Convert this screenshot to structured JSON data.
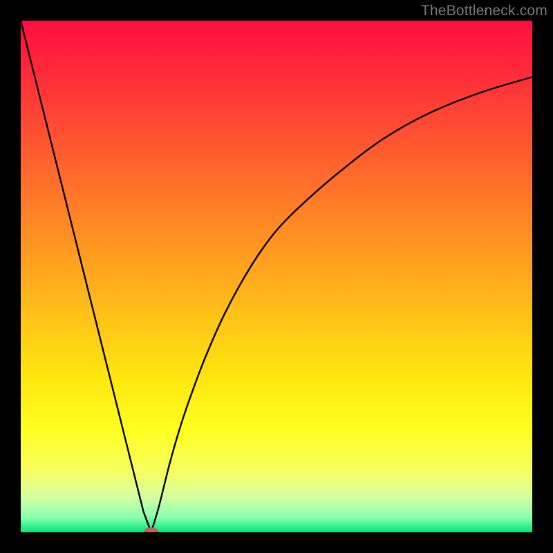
{
  "watermark": "TheBottleneck.com",
  "colors": {
    "gradient_stops": [
      {
        "offset": 0.0,
        "color": "#ff0e3f"
      },
      {
        "offset": 0.1,
        "color": "#ff2a3a"
      },
      {
        "offset": 0.25,
        "color": "#ff5a2f"
      },
      {
        "offset": 0.4,
        "color": "#ff8a24"
      },
      {
        "offset": 0.55,
        "color": "#ffb91a"
      },
      {
        "offset": 0.7,
        "color": "#ffe70f"
      },
      {
        "offset": 0.8,
        "color": "#ffff20"
      },
      {
        "offset": 0.88,
        "color": "#f7ff60"
      },
      {
        "offset": 0.93,
        "color": "#d6ffa0"
      },
      {
        "offset": 0.97,
        "color": "#8cffb0"
      },
      {
        "offset": 1.0,
        "color": "#00e67a"
      }
    ],
    "curve": "#000000",
    "marker_fill": "#c6605a",
    "marker_stroke": "#c6605a",
    "frame": "#000000"
  },
  "chart_data": {
    "type": "line",
    "title": "",
    "xlabel": "",
    "ylabel": "",
    "xlim": [
      0,
      100
    ],
    "ylim": [
      0,
      100
    ],
    "series": [
      {
        "name": "bottleneck-curve-left",
        "x": [
          0,
          2,
          4,
          6,
          8,
          10,
          12,
          14,
          16,
          18,
          20,
          22,
          24,
          25.5
        ],
        "y": [
          100,
          92,
          84,
          76,
          68,
          60,
          52,
          44,
          36,
          28,
          20,
          12,
          4,
          0
        ]
      },
      {
        "name": "bottleneck-curve-right",
        "x": [
          25.5,
          27,
          29,
          31,
          33,
          36,
          40,
          45,
          50,
          56,
          63,
          71,
          80,
          90,
          100
        ],
        "y": [
          0,
          5,
          13,
          20,
          26,
          34,
          43,
          52,
          59,
          65,
          71,
          77,
          82,
          86,
          89
        ]
      }
    ],
    "marker": {
      "x": 25.5,
      "y": 0,
      "rx": 1.4,
      "ry": 0.9
    }
  }
}
